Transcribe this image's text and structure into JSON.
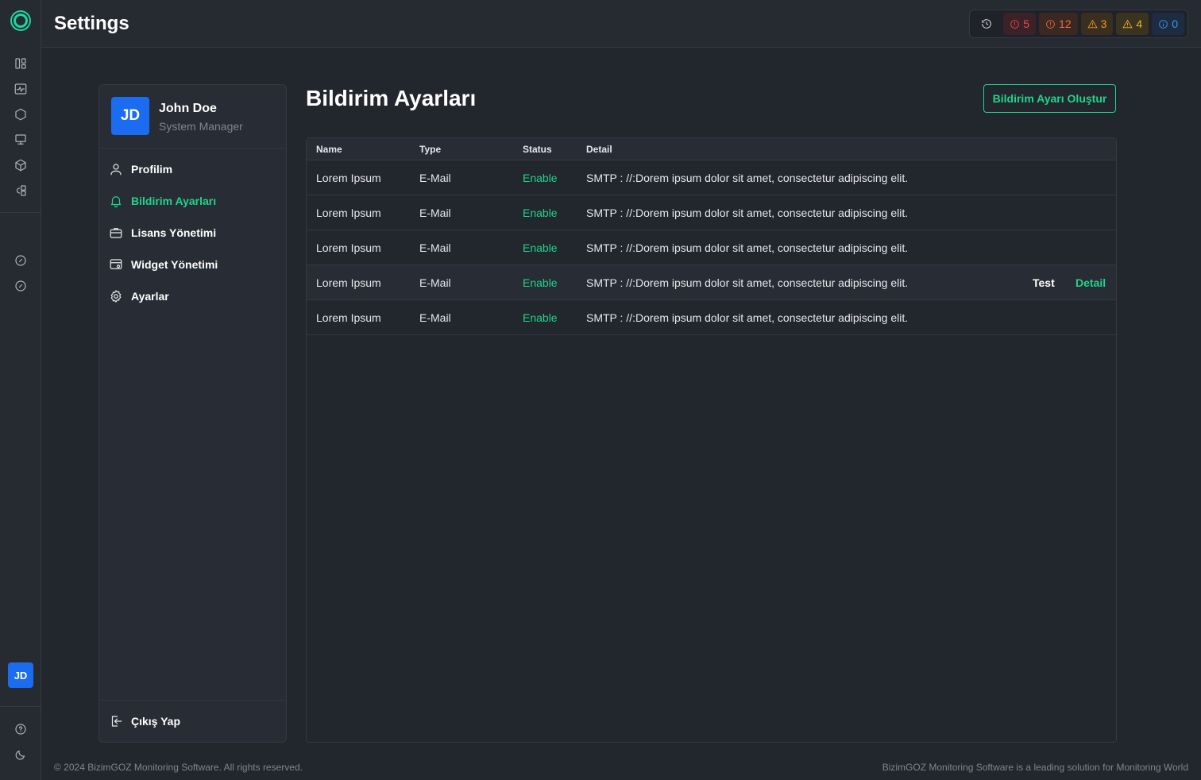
{
  "app": {
    "title": "Settings"
  },
  "rail": {
    "icons": [
      "layout-icon",
      "activity-icon",
      "hexagon-icon",
      "monitor-icon",
      "cube-icon",
      "shapes-icon",
      "compass-icon",
      "compass-alt-icon",
      "help-icon",
      "moon-icon"
    ],
    "avatar": "JD"
  },
  "alerts": {
    "history_icon": "history-icon",
    "items": [
      {
        "value": "5",
        "color": "#ef4b4b",
        "icon": "alert-circle-icon"
      },
      {
        "value": "12",
        "color": "#f26b3a",
        "icon": "alert-circle-icon"
      },
      {
        "value": "3",
        "color": "#f09a2a",
        "icon": "warning-triangle-icon"
      },
      {
        "value": "4",
        "color": "#eab53a",
        "icon": "warning-triangle-icon"
      },
      {
        "value": "0",
        "color": "#3b9af2",
        "icon": "info-circle-icon"
      }
    ]
  },
  "user": {
    "initials": "JD",
    "name": "John Doe",
    "role": "System Manager"
  },
  "menu": {
    "items": [
      {
        "label": "Profilim",
        "icon": "user-icon"
      },
      {
        "label": "Bildirim Ayarları",
        "icon": "bell-icon",
        "active": true
      },
      {
        "label": "Lisans Yönetimi",
        "icon": "briefcase-icon"
      },
      {
        "label": "Widget Yönetimi",
        "icon": "widget-settings-icon"
      },
      {
        "label": "Ayarlar",
        "icon": "gear-icon"
      }
    ],
    "logout": "Çıkış Yap"
  },
  "page": {
    "title": "Bildirim Ayarları",
    "create_button": "Bildirim Ayarı Oluştur"
  },
  "table": {
    "columns": [
      "Name",
      "Type",
      "Status",
      "Detail"
    ],
    "rows": [
      {
        "name": "Lorem Ipsum",
        "type": "E-Mail",
        "status": "Enable",
        "detail": "SMTP : //:Dorem ipsum dolor sit amet, consectetur adipiscing elit."
      },
      {
        "name": "Lorem Ipsum",
        "type": "E-Mail",
        "status": "Enable",
        "detail": "SMTP : //:Dorem ipsum dolor sit amet, consectetur adipiscing elit."
      },
      {
        "name": "Lorem Ipsum",
        "type": "E-Mail",
        "status": "Enable",
        "detail": "SMTP : //:Dorem ipsum dolor sit amet, consectetur adipiscing elit."
      },
      {
        "name": "Lorem Ipsum",
        "type": "E-Mail",
        "status": "Enable",
        "detail": "SMTP : //:Dorem ipsum dolor sit amet, consectetur adipiscing elit.",
        "actions": {
          "test": "Test",
          "detail": "Detail"
        }
      },
      {
        "name": "Lorem Ipsum",
        "type": "E-Mail",
        "status": "Enable",
        "detail": "SMTP : //:Dorem ipsum dolor sit amet, consectetur adipiscing elit."
      }
    ]
  },
  "footer": {
    "left": "© 2024 BizimGOZ Monitoring Software. All rights reserved.",
    "right": "BizimGOZ Monitoring Software is a leading solution for Monitoring World"
  },
  "colors": {
    "accent": "#1fd58a",
    "brand_blue": "#1c6cf2",
    "background": "#22262d"
  }
}
